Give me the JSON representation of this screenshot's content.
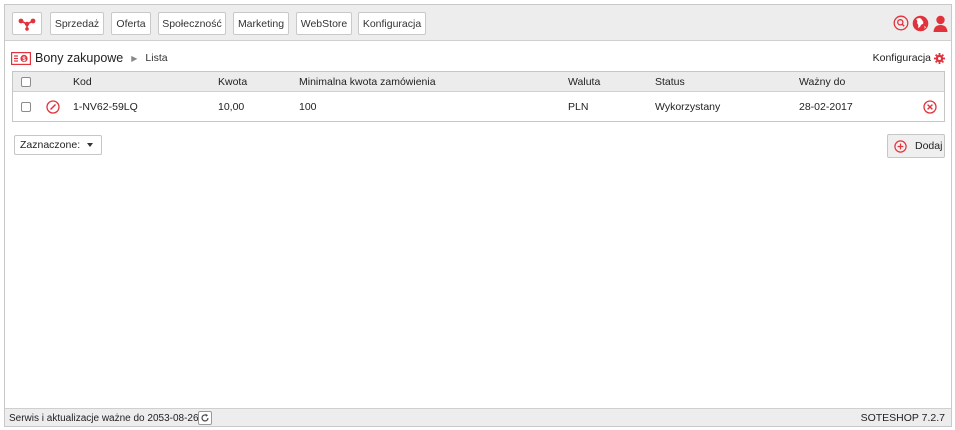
{
  "nav": {
    "logo_icon": "network-logo-icon",
    "items": [
      {
        "label": "Sprzedaż"
      },
      {
        "label": "Oferta"
      },
      {
        "label": "Społeczność"
      },
      {
        "label": "Marketing"
      },
      {
        "label": "WebStore"
      },
      {
        "label": "Konfiguracja"
      }
    ],
    "right_icons": [
      "search-icon",
      "globe-icon",
      "user-icon"
    ]
  },
  "breadcrumb": {
    "icon": "voucher-list-icon",
    "title": "Bony zakupowe",
    "current": "Lista"
  },
  "config_link": {
    "label": "Konfiguracja",
    "icon": "gear-icon"
  },
  "table": {
    "columns": [
      "Kod",
      "Kwota",
      "Minimalna kwota zamówienia",
      "Waluta",
      "Status",
      "Ważny do"
    ],
    "rows": [
      {
        "kod": "1-NV62-59LQ",
        "kwota": "10,00",
        "min": "100",
        "waluta": "PLN",
        "status": "Wykorzystany",
        "wazny": "28-02-2017"
      }
    ]
  },
  "bulk": {
    "label": "Zaznaczone:"
  },
  "add_button": {
    "label": "Dodaj",
    "icon": "plus-circle-icon"
  },
  "footer": {
    "service_text": "Serwis i aktualizacje ważne do 2053-08-26",
    "version": "SOTESHOP 7.2.7"
  },
  "colors": {
    "accent": "#e2323c",
    "toolbar_bg": "#ededed",
    "border": "#c8c8c8"
  }
}
